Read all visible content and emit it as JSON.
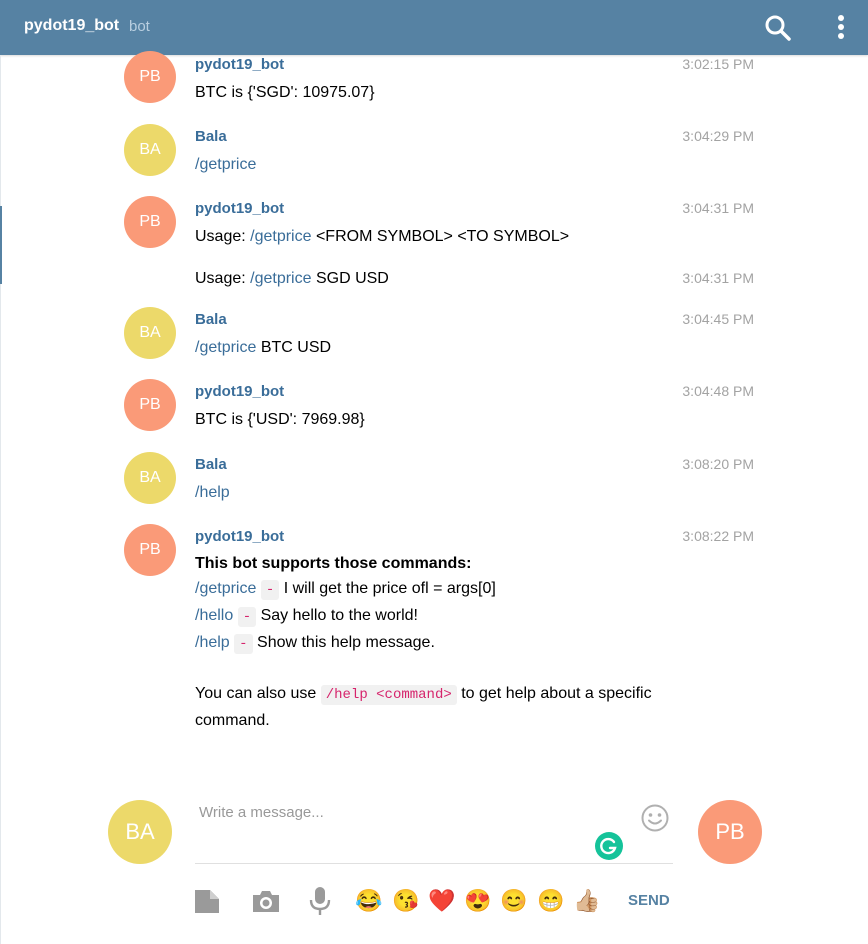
{
  "header": {
    "bot_name": "pydot19_bot",
    "bot_tag": "bot"
  },
  "messages": [
    {
      "avatar": "PB",
      "author": "pydot19_bot",
      "time": "3:02:15 PM",
      "text": "BTC is {'SGD': 10975.07}"
    },
    {
      "avatar": "BA",
      "author": "Bala",
      "time": "3:04:29 PM",
      "command": "/getprice"
    },
    {
      "avatar": "PB",
      "author": "pydot19_bot",
      "time": "3:04:31 PM",
      "prefix": "Usage: ",
      "command": "/getprice",
      "suffix": " <FROM SYMBOL> <TO SYMBOL>"
    },
    {
      "time": "3:04:31 PM",
      "prefix": "Usage: ",
      "command": "/getprice",
      "suffix": " SGD USD"
    },
    {
      "avatar": "BA",
      "author": "Bala",
      "time": "3:04:45 PM",
      "command": "/getprice",
      "suffix": " BTC USD"
    },
    {
      "avatar": "PB",
      "author": "pydot19_bot",
      "time": "3:04:48 PM",
      "text": "BTC is {'USD': 7969.98}"
    },
    {
      "avatar": "BA",
      "author": "Bala",
      "time": "3:08:20 PM",
      "command": "/help"
    },
    {
      "avatar": "PB",
      "author": "pydot19_bot",
      "time": "3:08:22 PM",
      "help": {
        "heading": "This bot supports those commands:",
        "dash": "-",
        "commands": [
          {
            "cmd": "/getprice",
            "desc": "I will get the price ofl = args[0]"
          },
          {
            "cmd": "/hello",
            "desc": "Say hello to the world!"
          },
          {
            "cmd": "/help",
            "desc": "Show this help message."
          }
        ],
        "footer_pre": "You can also use",
        "footer_code": "/help <command>",
        "footer_post": "to get help about a specific command."
      }
    }
  ],
  "composer": {
    "placeholder": "Write a message...",
    "value": "",
    "self_avatar": "BA",
    "peer_avatar": "PB",
    "send_label": "SEND"
  },
  "toolbar": {
    "icons": [
      "file-icon",
      "camera-icon",
      "microphone-icon"
    ],
    "emojis": [
      "😂",
      "😘",
      "❤️",
      "😍",
      "😊",
      "😁",
      "👍🏼"
    ]
  },
  "colors": {
    "header": "#5682a3",
    "link": "#3a6d99",
    "avatar_pb": "#fa9a78",
    "avatar_ba": "#ecd96a"
  }
}
